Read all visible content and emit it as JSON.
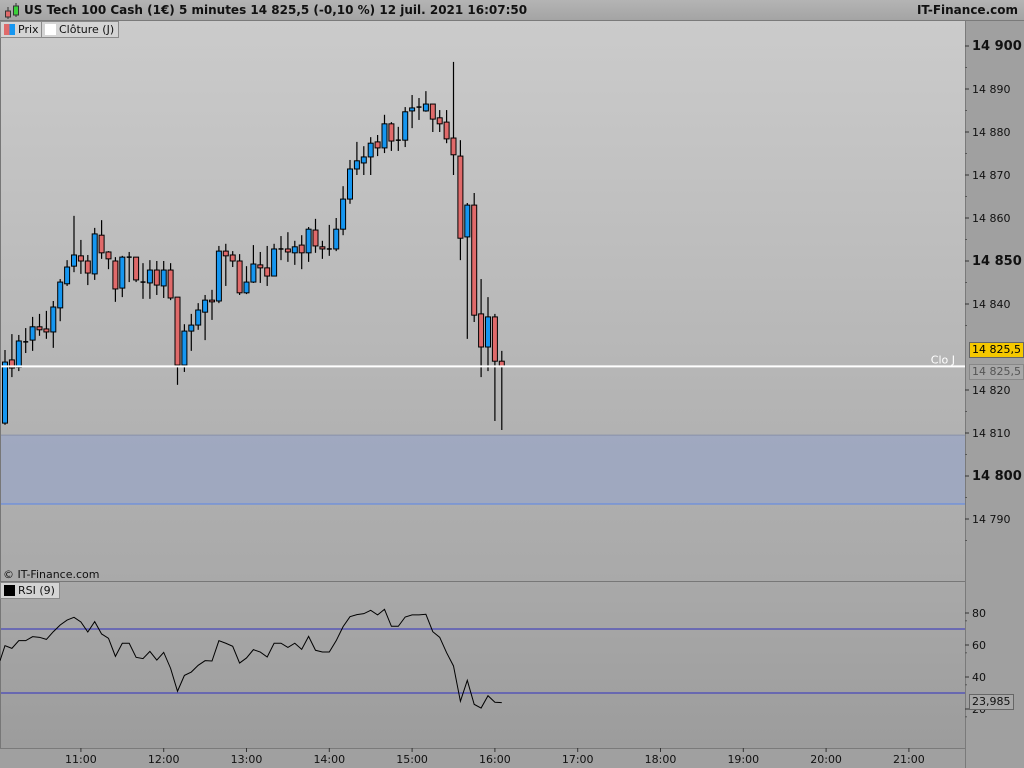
{
  "titlebar": {
    "title": "US Tech 100 Cash (1€) 5 minutes 14 825,5 (-0,10 %) 12 juil. 2021 16:07:50",
    "brand": "IT-Finance.com",
    "icon": "candlestick-icon"
  },
  "legend": {
    "price_label": "Prix",
    "close_label": "Clôture (J)",
    "rsi_label": "RSI (9)"
  },
  "copyright": "© IT-Finance.com",
  "colors": {
    "up": "#1596f0",
    "down": "#e06a6a",
    "zone": "#9aa6c4",
    "zone_line": "#5b86e8",
    "rsi_levels": "#3030c0",
    "last_price_bg": "#f5c800"
  },
  "price_axis": {
    "ticks": [
      {
        "value": 14900,
        "label": "14 900",
        "major": true
      },
      {
        "value": 14890,
        "label": "14 890",
        "major": false
      },
      {
        "value": 14880,
        "label": "14 880",
        "major": false
      },
      {
        "value": 14870,
        "label": "14 870",
        "major": false
      },
      {
        "value": 14860,
        "label": "14 860",
        "major": false
      },
      {
        "value": 14850,
        "label": "14 850",
        "major": true
      },
      {
        "value": 14840,
        "label": "14 840",
        "major": false
      },
      {
        "value": 14820,
        "label": "14 820",
        "major": false
      },
      {
        "value": 14810,
        "label": "14 810",
        "major": false
      },
      {
        "value": 14800,
        "label": "14 800",
        "major": true
      },
      {
        "value": 14790,
        "label": "14 790",
        "major": false
      }
    ],
    "last_price": 14825.5,
    "last_price_label": "14 825,5",
    "close_j_value": 14825.5,
    "close_j_label": "14 825,5",
    "close_j_line_label": "Clo J"
  },
  "zone": {
    "top": 14809.5,
    "bottom": 14793.5
  },
  "time_axis": {
    "start": "10:05",
    "interval_minutes": 5,
    "labels": [
      "11:00",
      "12:00",
      "13:00",
      "14:00",
      "15:00",
      "16:00",
      "17:00",
      "18:00",
      "19:00",
      "20:00",
      "21:00"
    ]
  },
  "candles_ohlc": [
    [
      14812.3,
      14829.3,
      14811.9,
      14826.5
    ],
    [
      14827.0,
      14833.0,
      14823.0,
      14825.1
    ],
    [
      14825.3,
      14832.8,
      14824.4,
      14831.4
    ],
    [
      14831.2,
      14834.4,
      14828.6,
      14831.2
    ],
    [
      14831.6,
      14837.0,
      14829.1,
      14834.7
    ],
    [
      14834.7,
      14837.7,
      14832.6,
      14834.0
    ],
    [
      14834.2,
      14838.4,
      14831.9,
      14833.5
    ],
    [
      14833.5,
      14840.7,
      14829.8,
      14839.3
    ],
    [
      14839.1,
      14845.8,
      14836.0,
      14845.1
    ],
    [
      14844.7,
      14850.2,
      14844.2,
      14848.6
    ],
    [
      14848.8,
      14860.5,
      14847.4,
      14851.4
    ],
    [
      14851.2,
      14854.9,
      14847.0,
      14850.0
    ],
    [
      14850.0,
      14851.4,
      14844.4,
      14847.2
    ],
    [
      14847.0,
      14857.7,
      14845.6,
      14856.3
    ],
    [
      14856.0,
      14859.5,
      14850.5,
      14851.9
    ],
    [
      14852.1,
      14852.3,
      14848.1,
      14850.5
    ],
    [
      14850.0,
      14850.9,
      14840.5,
      14843.5
    ],
    [
      14843.7,
      14851.2,
      14841.6,
      14850.9
    ],
    [
      14850.9,
      14852.1,
      14845.1,
      14850.9
    ],
    [
      14850.9,
      14850.9,
      14845.1,
      14845.6
    ],
    [
      14845.1,
      14849.5,
      14841.2,
      14845.1
    ],
    [
      14844.9,
      14850.2,
      14841.2,
      14847.9
    ],
    [
      14847.9,
      14850.0,
      14842.1,
      14844.4
    ],
    [
      14844.2,
      14850.0,
      14841.4,
      14847.9
    ],
    [
      14847.9,
      14849.5,
      14840.9,
      14841.4
    ],
    [
      14841.6,
      14841.6,
      14821.2,
      14825.8
    ],
    [
      14825.8,
      14835.3,
      14824.2,
      14833.7
    ],
    [
      14833.7,
      14837.7,
      14829.1,
      14835.1
    ],
    [
      14835.1,
      14840.2,
      14834.0,
      14838.6
    ],
    [
      14838.1,
      14842.1,
      14831.6,
      14840.9
    ],
    [
      14840.9,
      14843.3,
      14836.3,
      14840.5
    ],
    [
      14840.7,
      14853.5,
      14840.2,
      14852.3
    ],
    [
      14852.3,
      14854.0,
      14844.2,
      14851.2
    ],
    [
      14851.4,
      14852.3,
      14848.6,
      14850.0
    ],
    [
      14850.0,
      14851.6,
      14842.1,
      14842.6
    ],
    [
      14842.6,
      14848.8,
      14842.3,
      14845.1
    ],
    [
      14845.1,
      14853.7,
      14844.9,
      14849.3
    ],
    [
      14849.1,
      14852.1,
      14844.9,
      14848.4
    ],
    [
      14848.4,
      14853.5,
      14844.2,
      14846.5
    ],
    [
      14846.5,
      14854.0,
      14846.5,
      14852.8
    ],
    [
      14852.8,
      14855.8,
      14850.2,
      14852.8
    ],
    [
      14852.8,
      14856.7,
      14849.8,
      14852.1
    ],
    [
      14851.9,
      14854.7,
      14849.1,
      14853.3
    ],
    [
      14853.7,
      14856.0,
      14848.1,
      14851.9
    ],
    [
      14851.9,
      14857.9,
      14849.8,
      14857.4
    ],
    [
      14857.2,
      14859.8,
      14851.9,
      14853.5
    ],
    [
      14853.3,
      14854.7,
      14850.5,
      14852.8
    ],
    [
      14852.8,
      14858.4,
      14851.2,
      14852.8
    ],
    [
      14852.8,
      14860.0,
      14852.3,
      14857.4
    ],
    [
      14857.4,
      14867.4,
      14856.0,
      14864.4
    ],
    [
      14864.4,
      14873.5,
      14863.3,
      14871.4
    ],
    [
      14871.4,
      14877.7,
      14870.0,
      14873.3
    ],
    [
      14872.8,
      14876.7,
      14870.0,
      14874.2
    ],
    [
      14874.2,
      14878.8,
      14870.0,
      14877.4
    ],
    [
      14877.7,
      14879.3,
      14874.4,
      14876.3
    ],
    [
      14876.3,
      14884.0,
      14875.1,
      14881.9
    ],
    [
      14881.9,
      14882.3,
      14875.6,
      14877.9
    ],
    [
      14878.1,
      14881.2,
      14875.6,
      14878.1
    ],
    [
      14878.1,
      14885.8,
      14876.5,
      14884.7
    ],
    [
      14884.9,
      14888.6,
      14880.9,
      14885.6
    ],
    [
      14885.8,
      14887.9,
      14882.8,
      14885.8
    ],
    [
      14884.9,
      14889.5,
      14884.7,
      14886.5
    ],
    [
      14886.5,
      14886.5,
      14880.0,
      14883.0
    ],
    [
      14883.3,
      14885.1,
      14880.0,
      14881.9
    ],
    [
      14882.3,
      14885.1,
      14877.4,
      14878.4
    ],
    [
      14878.6,
      14896.3,
      14870.0,
      14874.7
    ],
    [
      14874.4,
      14878.1,
      14850.2,
      14855.3
    ],
    [
      14855.6,
      14863.5,
      14831.9,
      14863.0
    ],
    [
      14863.0,
      14865.8,
      14835.8,
      14837.4
    ],
    [
      14837.7,
      14845.8,
      14823.0,
      14830.0
    ],
    [
      14830.0,
      14841.6,
      14824.4,
      14837.0
    ],
    [
      14837.0,
      14837.7,
      14812.8,
      14826.7
    ],
    [
      14826.7,
      14829.1,
      14810.7,
      14825.5
    ]
  ],
  "rsi": {
    "period": 9,
    "levels": [
      70,
      30
    ],
    "ticks": [
      {
        "value": 80,
        "label": "80"
      },
      {
        "value": 60,
        "label": "60"
      },
      {
        "value": 40,
        "label": "40"
      },
      {
        "value": 20,
        "label": "20"
      }
    ],
    "last_label": "23,985",
    "values": [
      59.6,
      57.9,
      62.7,
      62.7,
      65.2,
      64.8,
      63.5,
      68.3,
      72.5,
      75.6,
      77.3,
      74.4,
      68.1,
      74.6,
      66.9,
      64.2,
      52.9,
      61.1,
      61.1,
      52.3,
      51.5,
      56.0,
      50.6,
      55.4,
      45.4,
      31.1,
      41.0,
      43.1,
      47.3,
      50.2,
      50.0,
      62.7,
      61.1,
      59.2,
      48.7,
      51.9,
      57.1,
      55.6,
      52.5,
      61.1,
      61.1,
      58.5,
      61.1,
      57.3,
      65.4,
      56.7,
      55.6,
      55.6,
      62.7,
      71.5,
      77.7,
      79.0,
      79.6,
      81.7,
      78.8,
      82.3,
      71.7,
      71.7,
      77.5,
      78.8,
      78.8,
      79.2,
      68.3,
      64.8,
      55.2,
      46.9,
      24.8,
      37.9,
      22.9,
      20.6,
      28.3,
      24.2,
      23.985
    ]
  }
}
